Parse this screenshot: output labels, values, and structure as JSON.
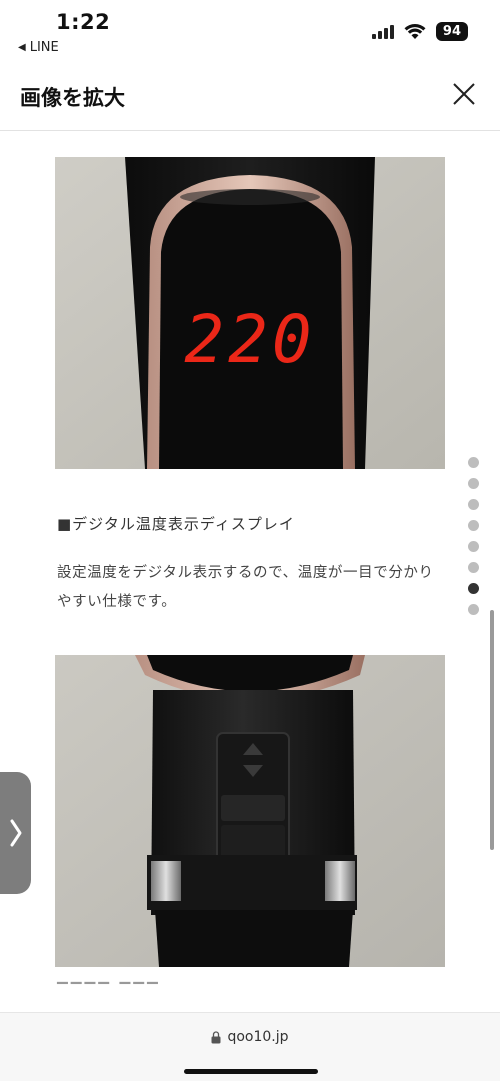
{
  "status": {
    "time": "1:22",
    "back_app": "LINE",
    "battery": "94"
  },
  "header": {
    "title": "画像を拡大"
  },
  "display": {
    "temperature_readout": "220"
  },
  "caption": {
    "title": "■デジタル温度表示ディスプレイ",
    "body": "設定温度をデジタル表示するので、温度が一目で分かりやすい仕様です。"
  },
  "pager": {
    "total": 8,
    "active": 7
  },
  "browser": {
    "url": "qoo10.jp"
  },
  "icons": {
    "close": "close-icon",
    "lock": "lock-icon",
    "chevron": "chevron-right-icon"
  }
}
